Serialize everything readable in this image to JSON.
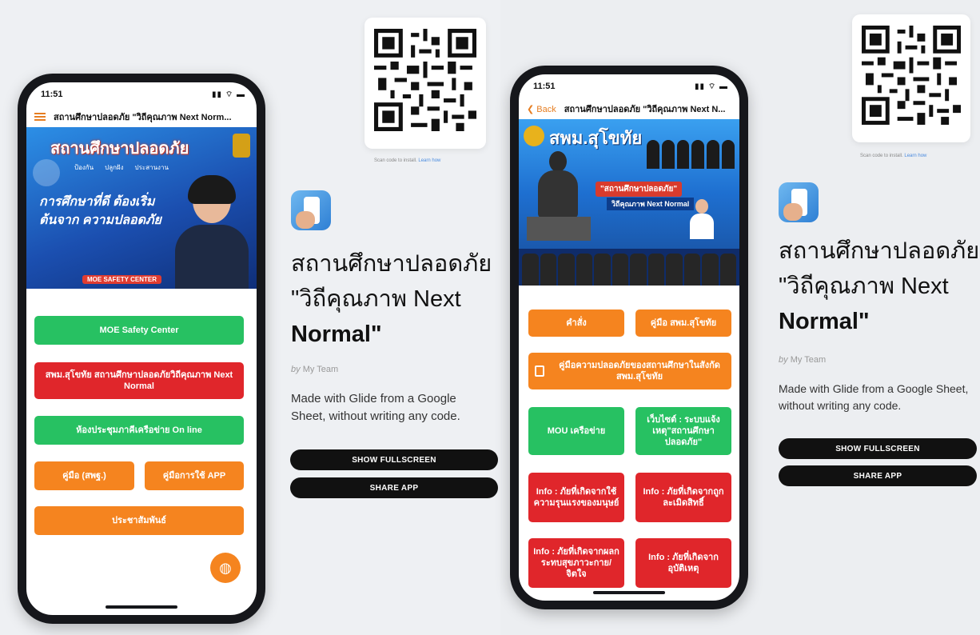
{
  "colors": {
    "accent_orange": "#f5841f",
    "green": "#27c162",
    "red": "#e0262b",
    "phone_frame": "#16171b"
  },
  "left": {
    "phone": {
      "time": "11:51",
      "status_icons": "▮▮ ⌔ ▬",
      "header_title": "สถานศึกษาปลอดภัย \"วิถีคุณภาพ Next Norm...",
      "menu_icon": "hamburger-icon",
      "banner": {
        "headline": "สถานศึกษาปลอดภัย",
        "tags": [
          "ป้องกัน",
          "ปลูกฝัง",
          "ประสานงาน"
        ],
        "quote": "การศึกษาที่ดี ต้องเริ่มต้นจาก ความปลอดภัย",
        "footer": "MOE SAFETY CENTER"
      },
      "buttons": [
        "MOE Safety Center",
        "สพม.สุโขทัย สถานศึกษาปลอดภัยวิถีคุณภาพ Next Normal",
        "ห้องประชุมภาคีเครือข่าย On line",
        "คู่มือ (สพฐ.)",
        "คู่มือการใช้ APP",
        "ประชาสัมพันธ์"
      ],
      "fab_icon": "globe-icon"
    },
    "qr_caption": "Scan code to install.",
    "qr_link": "Learn how",
    "app_title_line1": "สถานศึกษาปลอดภัย",
    "app_title_line2": "\"วิถีคุณภาพ Next",
    "app_title_line3": "Normal\"",
    "by_prefix": "by",
    "by_team": "My Team",
    "description": "Made with Glide from a Google Sheet, without writing any code.",
    "show_fullscreen": "SHOW FULLSCREEN",
    "share_app": "SHARE APP"
  },
  "right": {
    "phone": {
      "time": "11:51",
      "status_icons": "▮▮ ⌔ ▬",
      "back_label": "Back",
      "header_title": "สถานศึกษาปลอดภัย \"วิถีคุณภาพ Next N...",
      "banner": {
        "headline": "สพม.สุโขทัย",
        "quote": "\"สถานศึกษาปลอดภัย\"",
        "subquote": "วิถีคุณภาพ Next Normal"
      },
      "buttons": [
        "คำสั่ง",
        "คู่มือ สพม.สุโขทัย",
        "คู่มือความปลอดภัยของสถานศึกษาในสังกัด สพม.สุโขทัย",
        "MOU เครือข่าย",
        "เว็บไซต์ : ระบบแจ้งเหตุ\"สถานศึกษาปลอดภัย\"",
        "Info : ภัยที่เกิดจากใช้ความรุนแรงของมนุษย์",
        "Info : ภัยที่เกิดจากถูกละเมิดสิทธิ์",
        "Info : ภัยที่เกิดจากผลกระทบสุขภาวะกาย/จิตใจ",
        "Info : ภัยที่เกิดจากอุบัติเหตุ"
      ]
    },
    "qr_caption": "Scan code to install.",
    "qr_link": "Learn how",
    "app_title_line1": "สถานศึกษาปลอดภัย",
    "app_title_line2": "\"วิถีคุณภาพ Next",
    "app_title_line3": "Normal\"",
    "by_prefix": "by",
    "by_team": "My Team",
    "description": "Made with Glide from a Google Sheet, without writing any code.",
    "show_fullscreen": "SHOW FULLSCREEN",
    "share_app": "SHARE APP"
  }
}
